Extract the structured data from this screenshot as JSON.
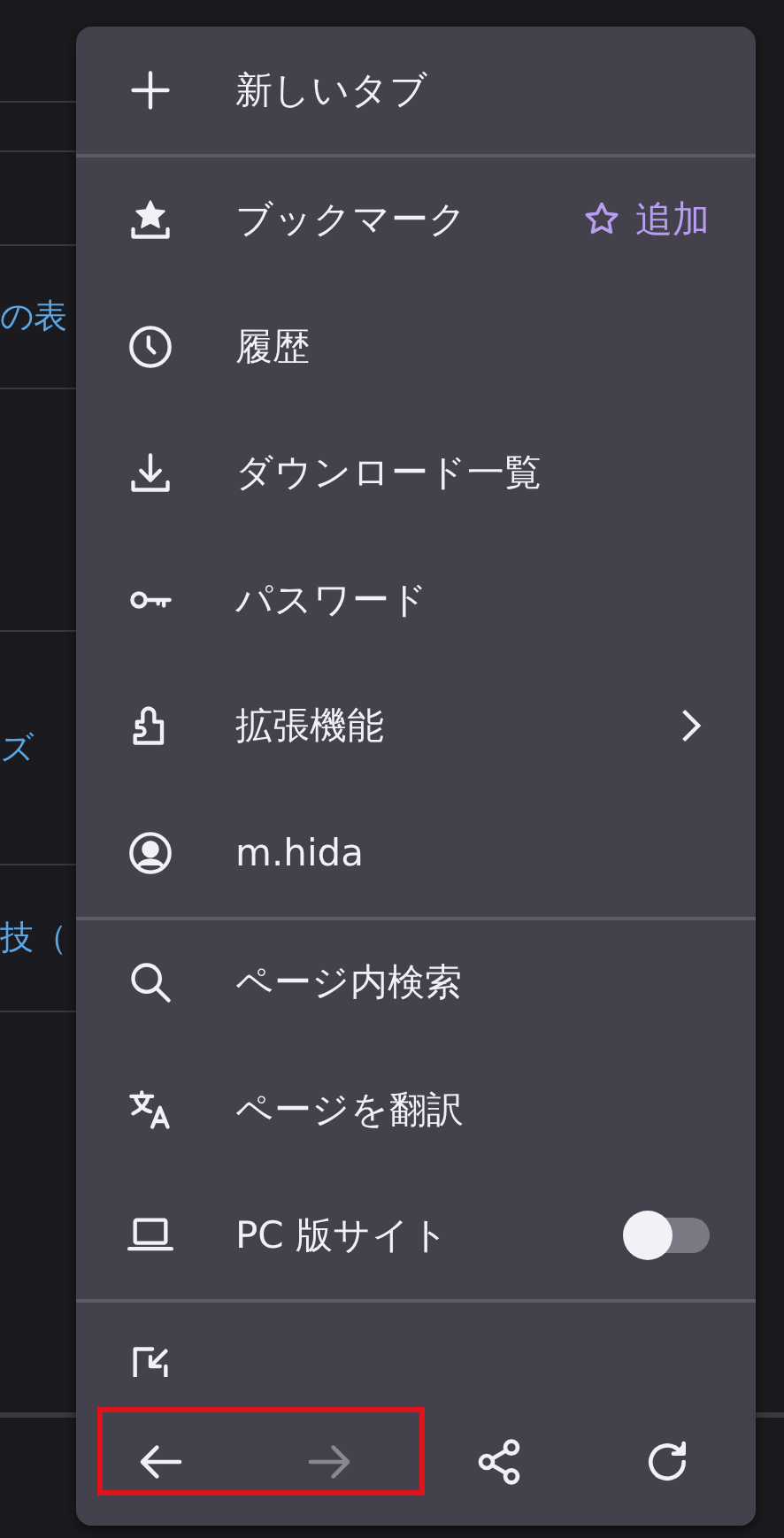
{
  "page": {
    "links": [
      {
        "label": "の表"
      },
      {
        "label": "ズ"
      },
      {
        "label": "技（"
      }
    ]
  },
  "menu": {
    "groups": [
      {
        "items": [
          {
            "kind": "plain",
            "label": "新しいタブ"
          }
        ]
      },
      {
        "items": [
          {
            "kind": "action",
            "label": "ブックマーク",
            "action": "追加"
          },
          {
            "kind": "plain",
            "label": "履歴"
          },
          {
            "kind": "plain",
            "label": "ダウンロード一覧"
          },
          {
            "kind": "plain",
            "label": "パスワード"
          },
          {
            "kind": "submenu",
            "label": "拡張機能"
          },
          {
            "kind": "plain",
            "label": "m.hida"
          }
        ]
      },
      {
        "items": [
          {
            "kind": "plain",
            "label": "ページ内検索"
          },
          {
            "kind": "plain",
            "label": "ページを翻訳"
          },
          {
            "kind": "toggle",
            "label": "PC 版サイト",
            "on": false
          }
        ]
      },
      {
        "items": [
          {
            "kind": "cut"
          }
        ]
      }
    ],
    "bottom_bar": {
      "nav_highlighted": true,
      "buttons": [
        {
          "disabled": false
        },
        {
          "disabled": true
        },
        {
          "disabled": false
        },
        {
          "disabled": false
        }
      ]
    }
  }
}
